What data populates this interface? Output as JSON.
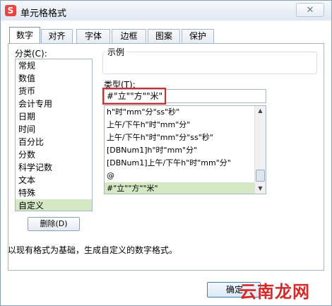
{
  "window": {
    "title": "单元格格式",
    "app_icon_letter": "S",
    "close_glyph": "✕"
  },
  "tabs": [
    {
      "label": "数字",
      "active": true
    },
    {
      "label": "对齐",
      "active": false
    },
    {
      "label": "字体",
      "active": false
    },
    {
      "label": "边框",
      "active": false
    },
    {
      "label": "图案",
      "active": false
    },
    {
      "label": "保护",
      "active": false
    }
  ],
  "category": {
    "label": "分类(C):",
    "items": [
      "常规",
      "数值",
      "货币",
      "会计专用",
      "日期",
      "时间",
      "百分比",
      "分数",
      "科学记数",
      "文本",
      "特殊",
      "自定义"
    ],
    "selected": "自定义"
  },
  "sample": {
    "label": "示例"
  },
  "type": {
    "label": "类型(T):",
    "value": "#\"立\"\"方\"\"米\""
  },
  "format_list": {
    "items": [
      "h\"时\"mm\"分\"ss\"秒\"",
      "上午/下午h\"时\"mm\"分\"",
      "上午/下午h\"时\"mm\"分\"ss\"秒\"",
      "[DBNum1]h\"时\"mm\"分\"",
      "[DBNum1]上午/下午h\"时\"mm\"分\"",
      "@",
      "#\"立\"\"方\"\"米\""
    ],
    "selected": "#\"立\"\"方\"\"米\""
  },
  "buttons": {
    "delete": "删除(D)",
    "ok": "确定"
  },
  "description": "以现有格式为基础，生成自定义的数字格式。",
  "watermark": "云南龙网",
  "colors": {
    "selection": "#d4e8c4",
    "highlight_border": "#d42a2a",
    "watermark": "#d42a2a"
  }
}
